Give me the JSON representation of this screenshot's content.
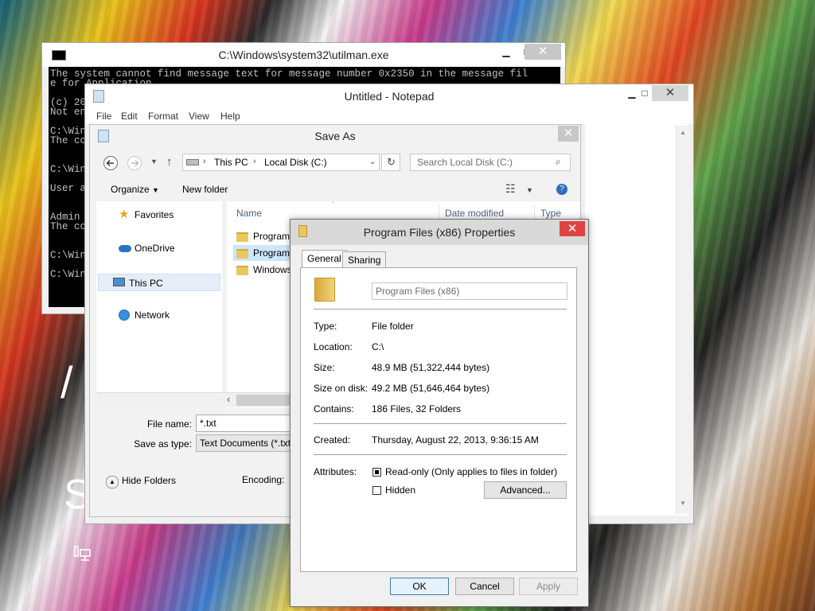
{
  "cmd": {
    "title": "C:\\Windows\\system32\\utilman.exe",
    "lines": [
      "The system cannot find message text for message number 0x2350 in the message fil",
      "e for Application.",
      "",
      "(c) 20",
      "Not en",
      "",
      "C:\\Win",
      "The co",
      "",
      "",
      "C:\\Win",
      "",
      "User a",
      "",
      "",
      "Admin",
      "The co",
      "",
      "",
      "C:\\Win",
      "",
      "C:\\Win"
    ]
  },
  "notepad": {
    "title": "Untitled - Notepad",
    "menu": [
      "File",
      "Edit",
      "Format",
      "View",
      "Help"
    ]
  },
  "saveas": {
    "title": "Save As",
    "breadcrumb": [
      "This PC",
      "Local Disk (C:)"
    ],
    "search_placeholder": "Search Local Disk (C:)",
    "organize": "Organize",
    "new_folder": "New folder",
    "nav": [
      "Favorites",
      "OneDrive",
      "This PC",
      "Network"
    ],
    "columns": [
      "Name",
      "Date modified",
      "Type"
    ],
    "files": [
      "Program",
      "Program",
      "Windows"
    ],
    "file_name_label": "File name:",
    "file_name_value": "*.txt",
    "save_type_label": "Save as type:",
    "save_type_value": "Text Documents (*.txt",
    "encoding_label": "Encoding:",
    "hide_folders": "Hide Folders"
  },
  "props": {
    "title": "Program Files (x86) Properties",
    "tabs": [
      "General",
      "Sharing"
    ],
    "name": "Program Files (x86)",
    "rows": [
      {
        "label": "Type:",
        "value": "File folder"
      },
      {
        "label": "Location:",
        "value": "C:\\"
      },
      {
        "label": "Size:",
        "value": "48.9 MB (51,322,444 bytes)"
      },
      {
        "label": "Size on disk:",
        "value": "49.2 MB (51,646,464 bytes)"
      },
      {
        "label": "Contains:",
        "value": "186 Files, 32 Folders"
      },
      {
        "label": "Created:",
        "value": "Thursday, August 22, 2013, 9:36:15 AM"
      }
    ],
    "attributes_label": "Attributes:",
    "readonly_label": "Read-only (Only applies to files in folder)",
    "hidden_label": "Hidden",
    "advanced": "Advanced...",
    "ok": "OK",
    "cancel": "Cancel",
    "apply": "Apply"
  },
  "lock_screen": {
    "glyph_top": "/",
    "glyph_bottom": "S"
  }
}
